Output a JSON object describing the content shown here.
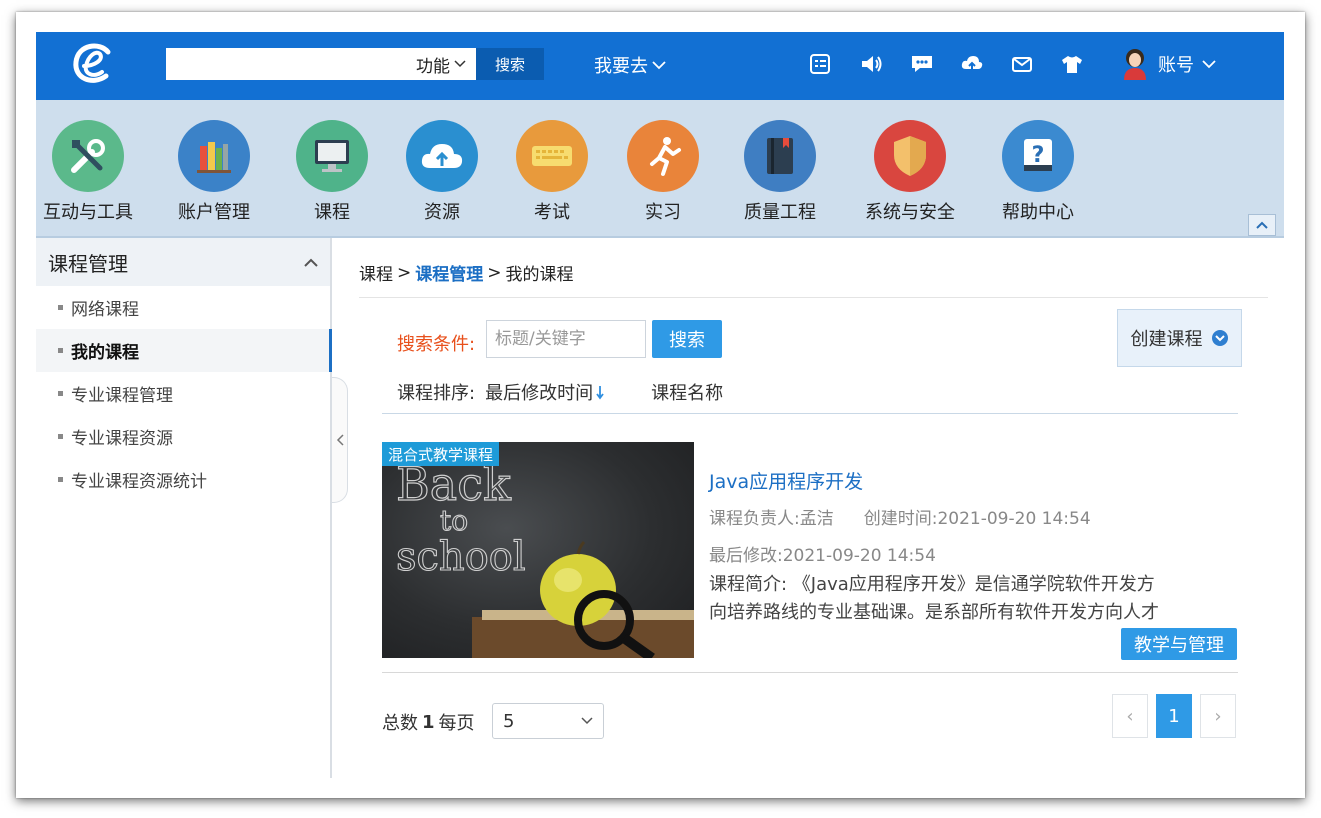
{
  "topbar": {
    "search_placeholder": "",
    "function_select": "功能",
    "search_button": "搜索",
    "goto_label": "我要去",
    "account_label": "账号",
    "icons": [
      "list-icon",
      "speaker-icon",
      "message-icon",
      "cloud-upload-icon",
      "mail-icon",
      "shirt-icon"
    ],
    "color": "#1270d3"
  },
  "nav": {
    "items": [
      {
        "label": "互动与工具",
        "icon": "tools-icon",
        "color": "#5bb98b"
      },
      {
        "label": "账户管理",
        "icon": "books-icon",
        "color": "#3b82c8"
      },
      {
        "label": "课程",
        "icon": "monitor-icon",
        "color": "#4fb38a"
      },
      {
        "label": "资源",
        "icon": "cloud-icon",
        "color": "#2a8fd0"
      },
      {
        "label": "考试",
        "icon": "keyboard-icon",
        "color": "#e89a3c"
      },
      {
        "label": "实习",
        "icon": "runner-icon",
        "color": "#e9843a"
      },
      {
        "label": "质量工程",
        "icon": "notebook-icon",
        "color": "#3f7ec2"
      },
      {
        "label": "系统与安全",
        "icon": "shield-icon",
        "color": "#d9463f"
      },
      {
        "label": "帮助中心",
        "icon": "help-icon",
        "color": "#3b8ad0"
      }
    ]
  },
  "sidebar": {
    "title": "课程管理",
    "items": [
      {
        "label": "网络课程"
      },
      {
        "label": "我的课程"
      },
      {
        "label": "专业课程管理"
      },
      {
        "label": "专业课程资源"
      },
      {
        "label": "专业课程资源统计"
      }
    ]
  },
  "breadcrumb": {
    "first": "课程",
    "current": "课程管理",
    "last": "我的课程"
  },
  "filter": {
    "condition_label": "搜索条件:",
    "keyword_placeholder": "标题/关键字",
    "search_button": "搜索",
    "create_button": "创建课程"
  },
  "sort": {
    "label": "课程排序:",
    "by_time": "最后修改时间",
    "by_name": "课程名称"
  },
  "course": {
    "tag": "混合式教学课程",
    "title": "Java应用程序开发",
    "owner": "课程负责人:孟洁",
    "created": "创建时间:2021-09-20 14:54",
    "modified": "最后修改:2021-09-20 14:54",
    "desc_line1": "课程简介: 《Java应用程序开发》是信通学院软件开发方",
    "desc_line2": "向培养路线的专业基础课。是系部所有软件开发方向人才",
    "manage_button": "教学与管理",
    "thumb_text": [
      "Back",
      "to",
      "school"
    ]
  },
  "pagination": {
    "total_label": "总数",
    "total": "1",
    "per_page_label": "每页",
    "page_size": "5",
    "prev": "‹",
    "current_page": "1",
    "next": "›"
  }
}
